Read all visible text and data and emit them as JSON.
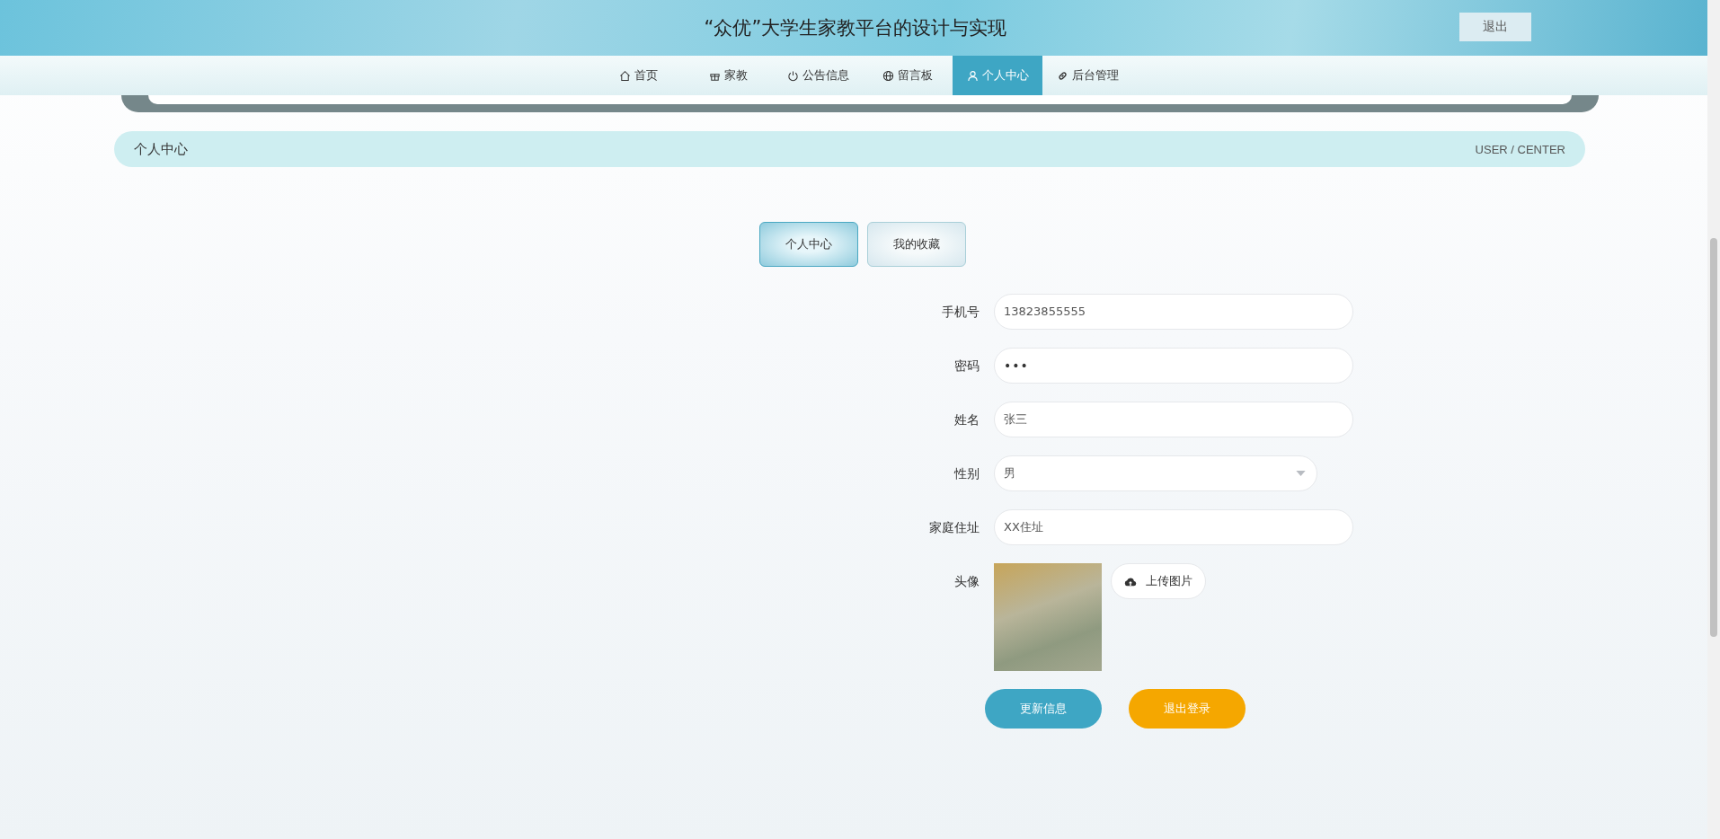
{
  "header": {
    "title": "“众优”大学生家教平台的设计与实现",
    "logout_button": "退出"
  },
  "nav": [
    {
      "label": "首页",
      "selected": false
    },
    {
      "label": "家教",
      "selected": false
    },
    {
      "label": "公告信息",
      "selected": false
    },
    {
      "label": "留言板",
      "selected": false
    },
    {
      "label": "个人中心",
      "selected": true
    },
    {
      "label": "后台管理",
      "selected": false
    }
  ],
  "breadcrumb": {
    "title": "个人中心",
    "path": "USER / CENTER"
  },
  "tabs": [
    {
      "label": "个人中心",
      "selected": true
    },
    {
      "label": "我的收藏",
      "selected": false
    }
  ],
  "form": {
    "fields": [
      {
        "kind": "text",
        "label": "手机号",
        "value": "13823855555"
      },
      {
        "kind": "password",
        "label": "密码",
        "value": "•••"
      },
      {
        "kind": "text",
        "label": "姓名",
        "value": "张三"
      },
      {
        "kind": "select",
        "label": "性别",
        "value": "男"
      },
      {
        "kind": "text",
        "label": "家庭住址",
        "value": "XX住址"
      },
      {
        "kind": "image",
        "label": "头像",
        "button": "上传图片"
      }
    ],
    "buttons": [
      {
        "kind": "primary",
        "label": "更新信息"
      },
      {
        "kind": "warning",
        "label": "退出登录"
      }
    ]
  }
}
